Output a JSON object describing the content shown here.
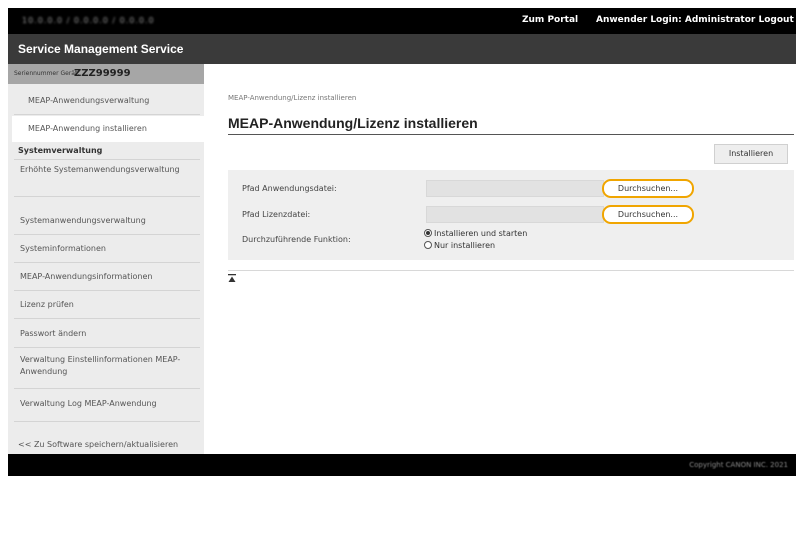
{
  "topbar": {
    "address": "10.0.0.0 / 0.0.0.0 / 0.0.0.0 /",
    "portal_link": "Zum Portal",
    "login_text": "Anwender Login: Administrator  Logout"
  },
  "app_title": "Service Management Service",
  "serial": {
    "label": "Seriennummer Gerät:",
    "value": "ZZZ99999"
  },
  "sidebar": {
    "items": [
      "MEAP-Anwendungsverwaltung",
      "MEAP-Anwendung installieren"
    ],
    "section_header": "Systemverwaltung",
    "system_items": [
      "Erhöhte Systemanwendungsverwaltung",
      "Systemanwendungsverwaltung",
      "Systeminformationen",
      "MEAP-Anwendungsinformationen",
      "Lizenz prüfen",
      "Passwort ändern",
      "Verwaltung Einstellinformationen MEAP-Anwendung",
      "Verwaltung Log MEAP-Anwendung"
    ],
    "bottom_link": "<< Zu Software speichern/aktualisieren"
  },
  "main": {
    "breadcrumb": "MEAP-Anwendung/Lizenz installieren",
    "title": "MEAP-Anwendung/Lizenz installieren",
    "install_button": "Installieren",
    "form": {
      "app_path_label": "Pfad Anwendungsdatei:",
      "license_path_label": "Pfad Lizenzdatei:",
      "function_label": "Durchzuführende Funktion:",
      "browse_label": "Durchsuchen...",
      "radio_options": [
        "Installieren und starten",
        "Nur installieren"
      ],
      "selected_option": "Installieren und starten"
    }
  },
  "footer": {
    "copyright": "Copyright CANON INC. 2021"
  },
  "colors": {
    "topbar": "#000000",
    "titlebar": "#3a3a3a",
    "accent_highlight": "#f0a500",
    "sidebar_bg": "#ececec"
  }
}
